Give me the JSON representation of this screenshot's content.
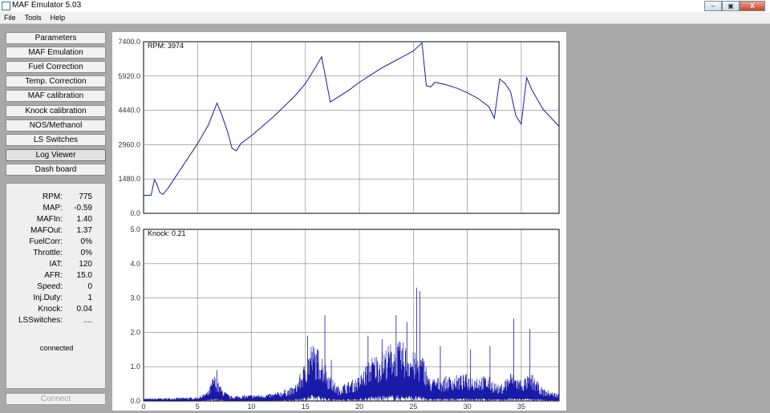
{
  "window": {
    "title": "MAF Emulator 5.03",
    "minimize": "‒",
    "maximize": "▣",
    "close": "X"
  },
  "menu": [
    "File",
    "Tools",
    "Help"
  ],
  "nav": [
    {
      "label": "Parameters"
    },
    {
      "label": "MAF Emulation"
    },
    {
      "label": "Fuel Correction"
    },
    {
      "label": "Temp. Correction"
    },
    {
      "label": "MAF calibration"
    },
    {
      "label": "Knock calibration"
    },
    {
      "label": "NOS/Methanol"
    },
    {
      "label": "LS Switches"
    },
    {
      "label": "Log Viewer"
    },
    {
      "label": "Dash board"
    }
  ],
  "active_nav": "Log Viewer",
  "readout": [
    {
      "label": "RPM:",
      "value": "775"
    },
    {
      "label": "MAP:",
      "value": "-0.59"
    },
    {
      "label": "MAFIn:",
      "value": "1.40"
    },
    {
      "label": "MAFOut:",
      "value": "1.37"
    },
    {
      "label": "FuelCorr:",
      "value": "0%"
    },
    {
      "label": "Throttle:",
      "value": "0%"
    },
    {
      "label": "IAT:",
      "value": "120"
    },
    {
      "label": "AFR:",
      "value": "15.0"
    },
    {
      "label": "Speed:",
      "value": "0"
    },
    {
      "label": "Inj.Duty:",
      "value": "1"
    },
    {
      "label": "Knock:",
      "value": "0.04"
    },
    {
      "label": "LSSwitches:",
      "value": "...."
    }
  ],
  "status": "connected",
  "connect_label": "Connect",
  "colors": {
    "series": "#1a1aa8",
    "grid": "#7f7f7f",
    "background": "#a9a9a9"
  },
  "chart_data": [
    {
      "type": "line",
      "title": "RPM: 3974",
      "xlabel": "",
      "ylabel": "",
      "ylim": [
        0,
        7400
      ],
      "xlim": [
        0,
        38.5
      ],
      "yticks": [
        "7400.0",
        "5920.0",
        "4440.0",
        "2960.0",
        "1480.0",
        "0.0"
      ],
      "grid": true,
      "series": [
        {
          "x": [
            0,
            0.7,
            0.8,
            1.0,
            1.2,
            1.5,
            1.8,
            2.3,
            3,
            4,
            5,
            6,
            6.8,
            7.2,
            7.8,
            8.2,
            8.6,
            9,
            10,
            11,
            12,
            13,
            14,
            15,
            16,
            16.5,
            17.3,
            17.8,
            19,
            20,
            21,
            22,
            23,
            24,
            25,
            25.8,
            26.2,
            26.6,
            27,
            28,
            29,
            30,
            31,
            32,
            32.5,
            33,
            33.5,
            34,
            34.5,
            35,
            35.5,
            36,
            37,
            38.5
          ],
          "y": [
            770,
            780,
            1000,
            1450,
            1300,
            900,
            820,
            1100,
            1600,
            2300,
            3000,
            3800,
            4750,
            4300,
            3500,
            2800,
            2700,
            3000,
            3350,
            3750,
            4150,
            4600,
            5050,
            5600,
            6350,
            6750,
            4800,
            4950,
            5300,
            5650,
            5950,
            6250,
            6500,
            6750,
            7000,
            7350,
            5500,
            5450,
            5650,
            5550,
            5400,
            5200,
            4950,
            4600,
            4100,
            5800,
            5600,
            5250,
            4200,
            3850,
            5850,
            5300,
            4500,
            3750
          ]
        }
      ]
    },
    {
      "type": "line",
      "title": "Knock: 0.21",
      "xlabel": "",
      "ylabel": "",
      "ylim": [
        0,
        5
      ],
      "xlim": [
        0,
        38.5
      ],
      "yticks": [
        "5.0",
        "4.0",
        "3.0",
        "2.0",
        "1.0",
        "0.0"
      ],
      "xticks": [
        "0",
        "5",
        "10",
        "15",
        "20",
        "25",
        "30",
        "35"
      ],
      "grid": true,
      "envelope": [
        {
          "x": 0,
          "y": 0.05
        },
        {
          "x": 5,
          "y": 0.08
        },
        {
          "x": 6,
          "y": 0.2
        },
        {
          "x": 6.5,
          "y": 0.55
        },
        {
          "x": 7.3,
          "y": 0.25
        },
        {
          "x": 8,
          "y": 0.1
        },
        {
          "x": 12,
          "y": 0.15
        },
        {
          "x": 14,
          "y": 0.3
        },
        {
          "x": 15,
          "y": 0.8
        },
        {
          "x": 15.5,
          "y": 1.2
        },
        {
          "x": 16.5,
          "y": 1.0
        },
        {
          "x": 17.3,
          "y": 0.5
        },
        {
          "x": 18,
          "y": 0.3
        },
        {
          "x": 20,
          "y": 0.5
        },
        {
          "x": 21,
          "y": 0.9
        },
        {
          "x": 22,
          "y": 1.0
        },
        {
          "x": 23,
          "y": 1.2
        },
        {
          "x": 24,
          "y": 1.2
        },
        {
          "x": 25,
          "y": 1.0
        },
        {
          "x": 26,
          "y": 0.9
        },
        {
          "x": 26.5,
          "y": 0.45
        },
        {
          "x": 28,
          "y": 0.5
        },
        {
          "x": 30,
          "y": 0.55
        },
        {
          "x": 32,
          "y": 0.5
        },
        {
          "x": 33,
          "y": 0.3
        },
        {
          "x": 34,
          "y": 0.6
        },
        {
          "x": 35,
          "y": 0.45
        },
        {
          "x": 36,
          "y": 0.55
        },
        {
          "x": 37,
          "y": 0.25
        },
        {
          "x": 38.5,
          "y": 0.15
        }
      ],
      "spikes": [
        {
          "x": 6.8,
          "y": 0.9
        },
        {
          "x": 15.2,
          "y": 1.9
        },
        {
          "x": 16.8,
          "y": 2.5
        },
        {
          "x": 17.4,
          "y": 1.2
        },
        {
          "x": 20.8,
          "y": 1.9
        },
        {
          "x": 22.1,
          "y": 1.8
        },
        {
          "x": 23.4,
          "y": 2.5
        },
        {
          "x": 24.4,
          "y": 2.3
        },
        {
          "x": 25.3,
          "y": 3.3
        },
        {
          "x": 25.6,
          "y": 3.2
        },
        {
          "x": 27.5,
          "y": 1.6
        },
        {
          "x": 30.3,
          "y": 1.5
        },
        {
          "x": 32.1,
          "y": 1.6
        },
        {
          "x": 34.3,
          "y": 2.4
        },
        {
          "x": 35.8,
          "y": 2.1
        }
      ]
    }
  ]
}
